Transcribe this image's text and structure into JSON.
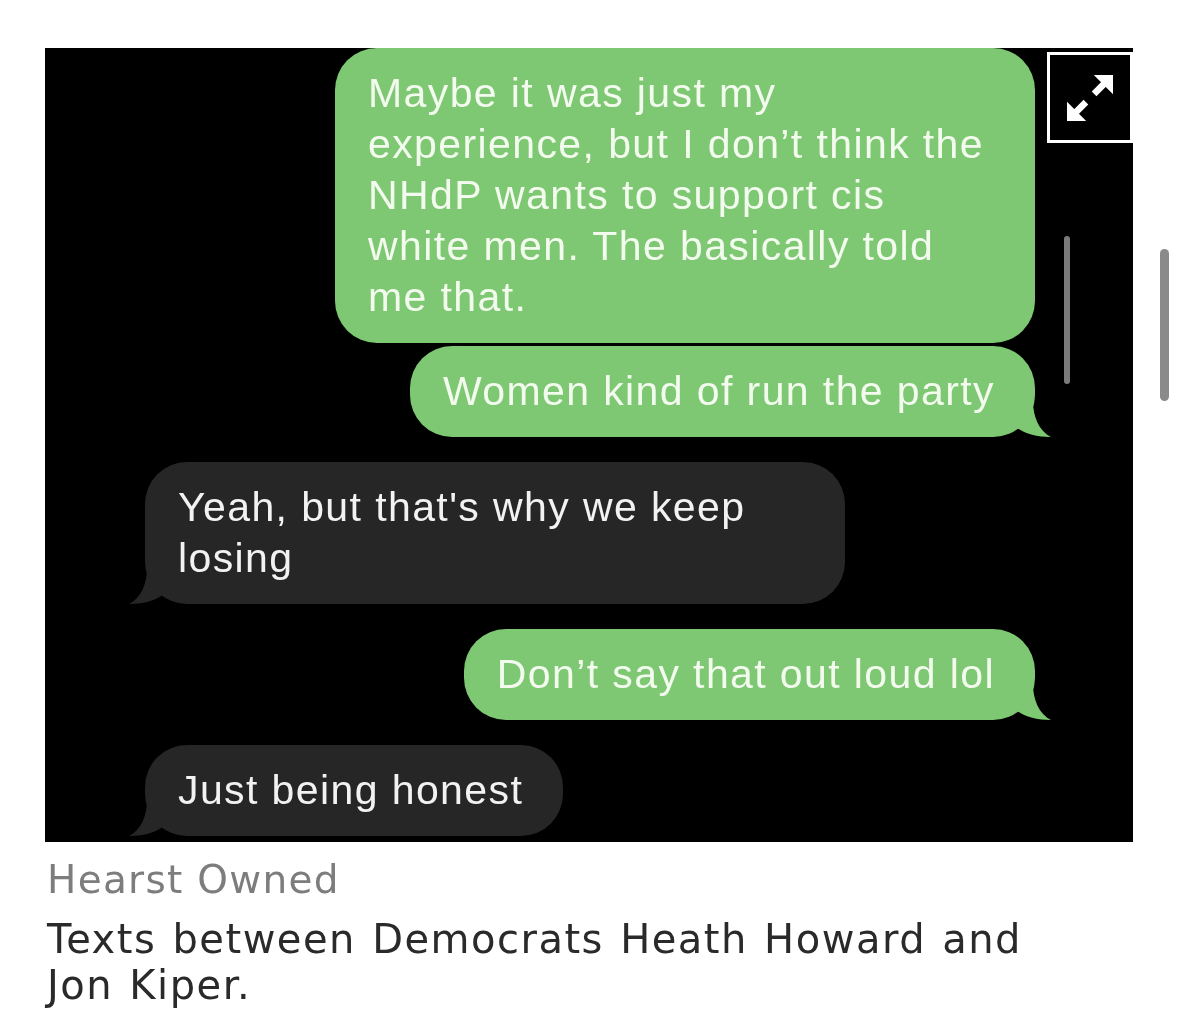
{
  "image": {
    "messages": [
      {
        "kind": "sent",
        "text": "Maybe it was just my experience, but I don’t think the NHdP wants to support cis white men. The basically told me that.",
        "tail": false
      },
      {
        "kind": "sent",
        "text": "Women kind of run the party",
        "tail": true
      },
      {
        "kind": "received",
        "text": "Yeah, but that's why we keep losing",
        "tail": true
      },
      {
        "kind": "sent",
        "text": "Don’t say that out loud lol",
        "tail": true
      },
      {
        "kind": "received",
        "text": "Just being honest",
        "tail": true
      }
    ]
  },
  "credit": "Hearst Owned",
  "caption": "Texts between Democrats Heath Howard and Jon Kiper."
}
